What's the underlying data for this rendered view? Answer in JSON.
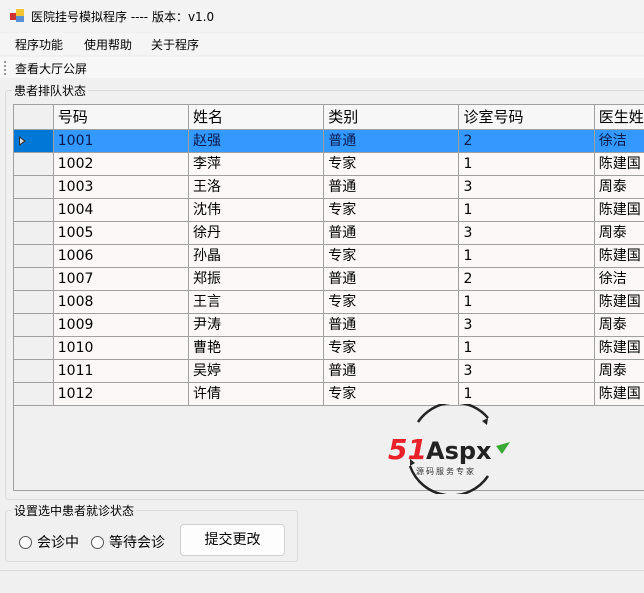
{
  "window": {
    "title": "医院挂号模拟程序 ---- 版本：v1.0"
  },
  "menu": [
    "程序功能",
    "使用帮助",
    "关于程序"
  ],
  "toolbar": {
    "button": "查看大厅公屏"
  },
  "queue_group": {
    "label": "患者排队状态"
  },
  "grid": {
    "columns": [
      "号码",
      "姓名",
      "类别",
      "诊室号码",
      "医生姓名"
    ],
    "selected_row": 0,
    "rows": [
      [
        "1001",
        "赵强",
        "普通",
        "2",
        "徐洁"
      ],
      [
        "1002",
        "李萍",
        "专家",
        "1",
        "陈建国"
      ],
      [
        "1003",
        "王洛",
        "普通",
        "3",
        "周泰"
      ],
      [
        "1004",
        "沈伟",
        "专家",
        "1",
        "陈建国"
      ],
      [
        "1005",
        "徐丹",
        "普通",
        "3",
        "周泰"
      ],
      [
        "1006",
        "孙晶",
        "专家",
        "1",
        "陈建国"
      ],
      [
        "1007",
        "郑振",
        "普通",
        "2",
        "徐洁"
      ],
      [
        "1008",
        "王言",
        "专家",
        "1",
        "陈建国"
      ],
      [
        "1009",
        "尹涛",
        "普通",
        "3",
        "周泰"
      ],
      [
        "1010",
        "曹艳",
        "专家",
        "1",
        "陈建国"
      ],
      [
        "1011",
        "吴婷",
        "普通",
        "3",
        "周泰"
      ],
      [
        "1012",
        "许倩",
        "专家",
        "1",
        "陈建国"
      ]
    ]
  },
  "watermark": {
    "brand": "51Aspx",
    "tagline": "源码服务专家"
  },
  "status_group": {
    "label": "设置选中患者就诊状态",
    "options": [
      "会诊中",
      "等待会诊"
    ],
    "submit": "提交更改"
  },
  "colors": {
    "selection": "#3399ff",
    "row_header_selected": "#0078d7"
  }
}
